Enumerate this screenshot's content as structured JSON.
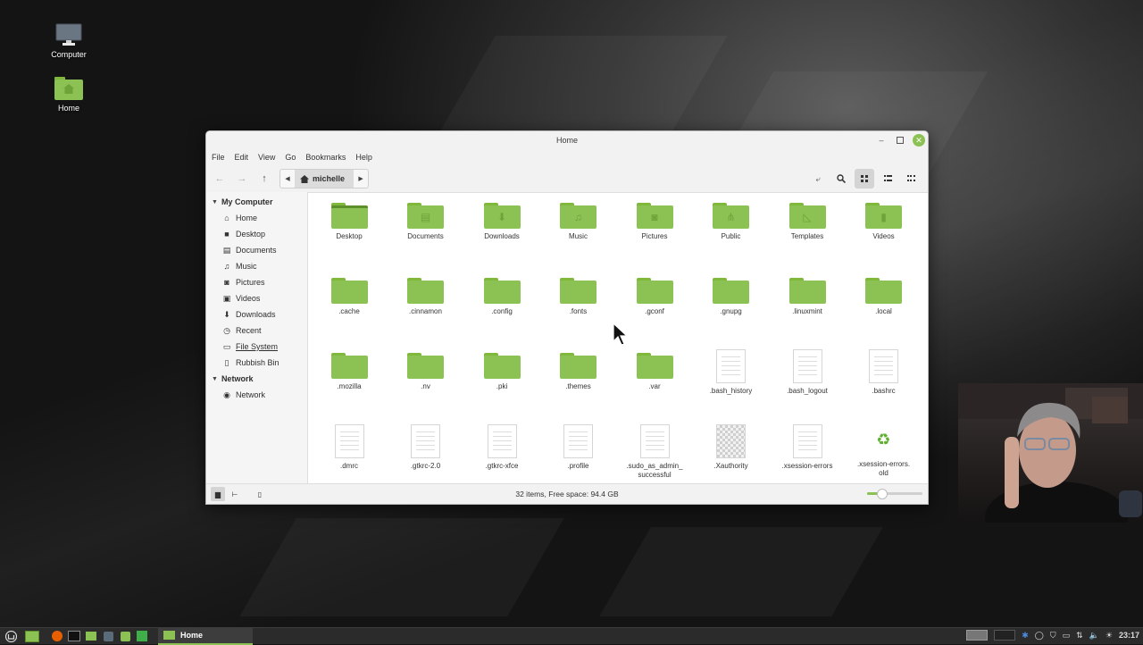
{
  "desktop": {
    "icons": [
      {
        "label": "Computer",
        "icon": "computer-icon"
      },
      {
        "label": "Home",
        "icon": "home-folder-icon"
      }
    ]
  },
  "window": {
    "title": "Home",
    "menu": [
      "File",
      "Edit",
      "View",
      "Go",
      "Bookmarks",
      "Help"
    ],
    "breadcrumb": {
      "current": "michelle"
    },
    "sidebar": {
      "sections": [
        {
          "label": "My Computer",
          "items": [
            {
              "label": "Home",
              "icon": "home-icon"
            },
            {
              "label": "Desktop",
              "icon": "desktop-icon"
            },
            {
              "label": "Documents",
              "icon": "document-icon"
            },
            {
              "label": "Music",
              "icon": "music-icon"
            },
            {
              "label": "Pictures",
              "icon": "camera-icon"
            },
            {
              "label": "Videos",
              "icon": "video-icon"
            },
            {
              "label": "Downloads",
              "icon": "download-icon"
            },
            {
              "label": "Recent",
              "icon": "clock-icon"
            },
            {
              "label": "File System",
              "icon": "drive-icon"
            },
            {
              "label": "Rubbish Bin",
              "icon": "trash-icon"
            }
          ]
        },
        {
          "label": "Network",
          "items": [
            {
              "label": "Network",
              "icon": "network-icon"
            }
          ]
        }
      ]
    },
    "files": [
      {
        "name": "Desktop",
        "type": "folder",
        "emblem": ""
      },
      {
        "name": "Documents",
        "type": "folder",
        "emblem": "document"
      },
      {
        "name": "Downloads",
        "type": "folder",
        "emblem": "download"
      },
      {
        "name": "Music",
        "type": "folder",
        "emblem": "music"
      },
      {
        "name": "Pictures",
        "type": "folder",
        "emblem": "camera"
      },
      {
        "name": "Public",
        "type": "folder",
        "emblem": "share"
      },
      {
        "name": "Templates",
        "type": "folder",
        "emblem": "template"
      },
      {
        "name": "Videos",
        "type": "folder",
        "emblem": "video"
      },
      {
        "name": ".cache",
        "type": "folder",
        "emblem": ""
      },
      {
        "name": ".cinnamon",
        "type": "folder",
        "emblem": ""
      },
      {
        "name": ".config",
        "type": "folder",
        "emblem": ""
      },
      {
        "name": ".fonts",
        "type": "folder",
        "emblem": ""
      },
      {
        "name": ".gconf",
        "type": "folder",
        "emblem": ""
      },
      {
        "name": ".gnupg",
        "type": "folder",
        "emblem": ""
      },
      {
        "name": ".linuxmint",
        "type": "folder",
        "emblem": ""
      },
      {
        "name": ".local",
        "type": "folder",
        "emblem": ""
      },
      {
        "name": ".mozilla",
        "type": "folder",
        "emblem": ""
      },
      {
        "name": ".nv",
        "type": "folder",
        "emblem": ""
      },
      {
        "name": ".pki",
        "type": "folder",
        "emblem": ""
      },
      {
        "name": ".themes",
        "type": "folder",
        "emblem": ""
      },
      {
        "name": ".var",
        "type": "folder",
        "emblem": ""
      },
      {
        "name": ".bash_history",
        "type": "file",
        "emblem": ""
      },
      {
        "name": ".bash_logout",
        "type": "file",
        "emblem": ""
      },
      {
        "name": ".bashrc",
        "type": "file",
        "emblem": ""
      },
      {
        "name": ".dmrc",
        "type": "file",
        "emblem": ""
      },
      {
        "name": ".gtkrc-2.0",
        "type": "file",
        "emblem": ""
      },
      {
        "name": ".gtkrc-xfce",
        "type": "file",
        "emblem": ""
      },
      {
        "name": ".profile",
        "type": "file",
        "emblem": ""
      },
      {
        "name": ".sudo_as_admin_\nsuccessful",
        "type": "file",
        "emblem": ""
      },
      {
        "name": ".Xauthority",
        "type": "image",
        "emblem": ""
      },
      {
        "name": ".xsession-errors",
        "type": "file",
        "emblem": ""
      },
      {
        "name": ".xsession-errors.\nold",
        "type": "recycle",
        "emblem": ""
      }
    ],
    "status": "32 items, Free space: 94.4 GB",
    "zoom_level": 0.25
  },
  "taskbar": {
    "active_window": "Home",
    "clock": "23:17"
  },
  "colors": {
    "accent": "#8cc153",
    "folder": "#8cc153",
    "taskbar": "#2b2b2b"
  }
}
